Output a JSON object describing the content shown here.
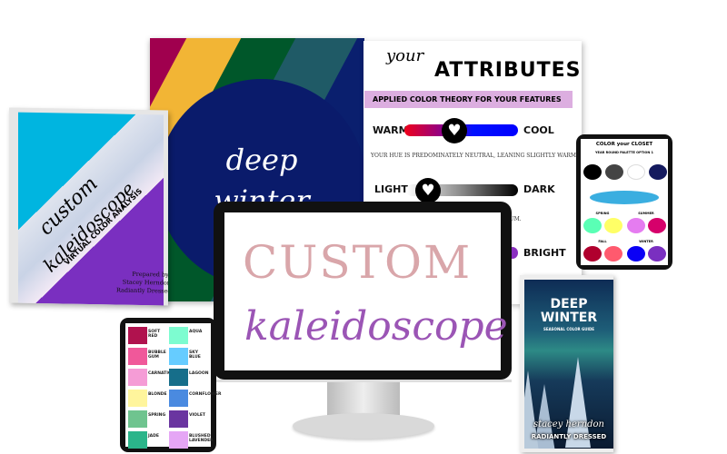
{
  "left_page": {
    "title_line1": "deep",
    "title_line2": "winter",
    "stripe_colors": [
      "#8b0018",
      "#a0004e",
      "#f2b535",
      "#00572a",
      "#1f5a66"
    ]
  },
  "attributes_page": {
    "script_word": "your",
    "heading": "ATTRIBUTES",
    "banner": "APPLIED COLOR THEORY FOR YOUR FEATURES",
    "sliders": [
      {
        "left": "WARM",
        "right": "COOL",
        "note": "YOUR HUE IS PREDOMINATELY NEUTRAL, LEANING SLIGHTLY WARM.",
        "position_pct": 48
      },
      {
        "left": "LIGHT",
        "right": "DARK",
        "note": "DS MEDIUM.",
        "position_pct": 15
      },
      {
        "right": "BRIGHT"
      }
    ]
  },
  "book": {
    "title_script_1": "custom",
    "title_script_2": "kaleidoscope",
    "subtitle": "VIRTUAL COLOR ANALYSIS",
    "prepared_by": "Prepared by:",
    "author": "Stacey Herndon",
    "company": "Radiantly Dressed"
  },
  "monitor": {
    "logo_line1": "CUSTOM",
    "logo_line2": "kaleidoscope"
  },
  "swatch_tablet": {
    "swatches": [
      {
        "name": "SOFT RED",
        "color": "#b0124e"
      },
      {
        "name": "AQUA",
        "color": "#7dfcd0"
      },
      {
        "name": "BUBBLE GUM",
        "color": "#f0589a"
      },
      {
        "name": "SKY BLUE",
        "color": "#66ccff"
      },
      {
        "name": "CARNATION",
        "color": "#f59cd6"
      },
      {
        "name": "LAGOON",
        "color": "#166e8a"
      },
      {
        "name": "BLONDE",
        "color": "#fff59c"
      },
      {
        "name": "CORNFLOWER",
        "color": "#4a8ae0"
      },
      {
        "name": "SPRING",
        "color": "#6fc48f"
      },
      {
        "name": "VIOLET",
        "color": "#6a35a0"
      },
      {
        "name": "JADE",
        "color": "#2bb58a"
      },
      {
        "name": "BLUSHED LAVENDER",
        "color": "#e5a6f5"
      }
    ]
  },
  "closet_tablet": {
    "title": "COLOR your CLOSET",
    "subtitle": "YEAR ROUND PALETTE OPTION 1",
    "neutrals": [
      "#000000",
      "#444444",
      "#ffffff",
      "#141a5e"
    ],
    "feature_color": "#3aaee0",
    "seasons": [
      {
        "name": "SPRING",
        "colors": [
          "#5affb5",
          "#ffff66"
        ]
      },
      {
        "name": "SUMMER",
        "colors": [
          "#e57cf0",
          "#d6006b"
        ]
      },
      {
        "name": "FALL",
        "colors": [
          "#b0002e",
          "#ff5a6e"
        ]
      },
      {
        "name": "WINTER",
        "colors": [
          "#0a00f5",
          "#7a2fc0"
        ]
      }
    ]
  },
  "guide": {
    "title_1": "DEEP",
    "title_2": "WINTER",
    "subtitle": "SEASONAL COLOR GUIDE",
    "author": "stacey herndon",
    "company": "RADIANTLY DRESSED"
  }
}
